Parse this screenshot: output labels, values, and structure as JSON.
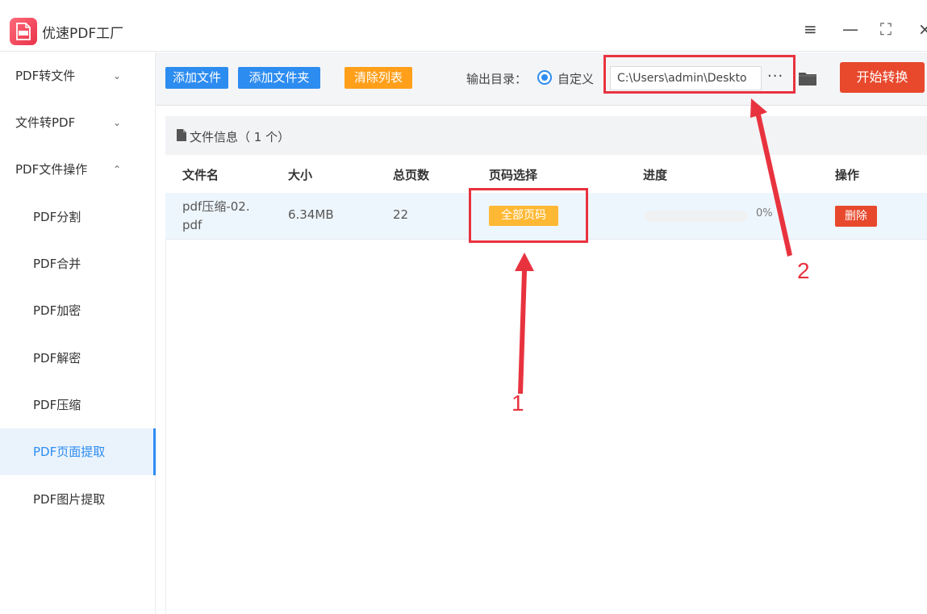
{
  "app": {
    "title": "优速PDF工厂"
  },
  "window": {
    "menu_glyph": "≡",
    "min_glyph": "—",
    "max_glyph": "⛶",
    "close_glyph": "×"
  },
  "sidebar": {
    "items": [
      {
        "label": "PDF转文件",
        "chevron": "⌄"
      },
      {
        "label": "文件转PDF",
        "chevron": "⌄"
      },
      {
        "label": "PDF文件操作",
        "chevron": "⌃"
      },
      {
        "label": "PDF分割"
      },
      {
        "label": "PDF合并"
      },
      {
        "label": "PDF加密"
      },
      {
        "label": "PDF解密"
      },
      {
        "label": "PDF压缩"
      },
      {
        "label": "PDF页面提取",
        "active": true
      },
      {
        "label": "PDF图片提取"
      }
    ]
  },
  "toolbar": {
    "add_file": "添加文件",
    "add_folder": "添加文件夹",
    "clear_list": "清除列表",
    "output_label": "输出目录：",
    "custom_option": "自定义",
    "output_path": "C:\\Users\\admin\\Deskto",
    "browse": "···",
    "start": "开始转换"
  },
  "file_list": {
    "info": "文件信息（ 1 个）",
    "columns": [
      "文件名",
      "大小",
      "总页数",
      "页码选择",
      "进度",
      "操作"
    ],
    "rows": [
      {
        "name_line1": "pdf压缩-02.",
        "name_line2": "pdf",
        "size": "6.34MB",
        "pages": "22",
        "page_select": "全部页码",
        "progress": 0,
        "progress_text": "0%",
        "action": "删除"
      }
    ]
  },
  "annotations": {
    "label_1": "1",
    "label_2": "2"
  },
  "colors": {
    "accent": "#2d8cf0",
    "orange": "#ff9f1a",
    "danger": "#e8482c",
    "annotation": "#e8333f"
  }
}
